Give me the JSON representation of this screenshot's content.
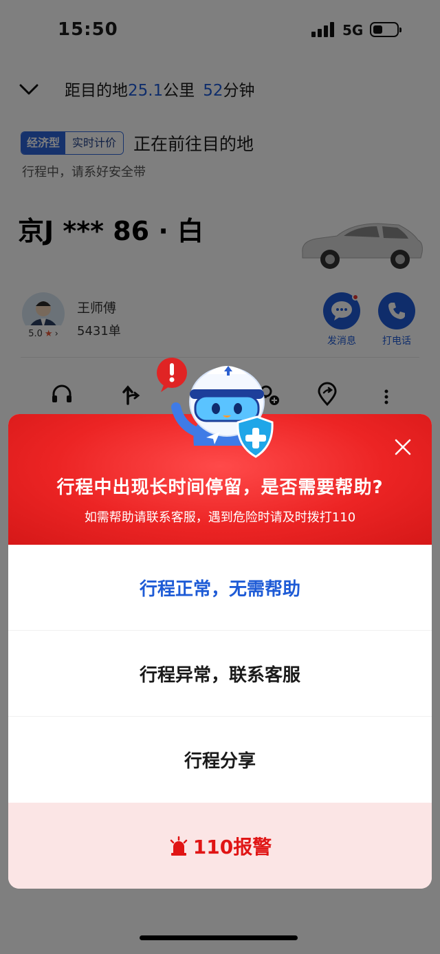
{
  "status_bar": {
    "time": "15:50",
    "network": "5G",
    "battery_level": 0.35
  },
  "nav": {
    "prefix": "距目的地",
    "distance_value": "25.1",
    "distance_unit": "公里",
    "time_value": "52",
    "time_unit": "分钟",
    "collapse_icon": "chevron-down-icon"
  },
  "trip": {
    "tag_type": "经济型",
    "tag_pricing": "实时计价",
    "status": "正在前往目的地",
    "subtitle": "行程中，请系好安全带"
  },
  "driver_card": {
    "plate": "京J *** 86 · 白",
    "driver_name": "王师傅",
    "orders": "5431单",
    "rating": "5.0",
    "message_label": "发消息",
    "call_label": "打电话"
  },
  "help_dialog": {
    "title": "行程中出现长时间停留，是否需要帮助?",
    "subtitle": "如需帮助请联系客服，遇到危险时请及时拨打110",
    "options": [
      {
        "label": "行程正常，无需帮助"
      },
      {
        "label": "行程异常，联系客服"
      },
      {
        "label": "行程分享"
      }
    ],
    "alarm_label": "110报警"
  },
  "colors": {
    "accent_blue": "#1e5bd6",
    "alert_red": "#ec2424",
    "alarm_bg": "#fbe5e5"
  }
}
